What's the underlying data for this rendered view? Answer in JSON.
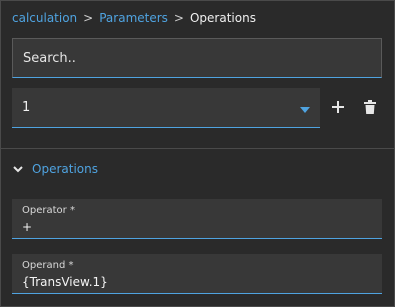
{
  "breadcrumb": {
    "items": [
      "calculation",
      "Parameters"
    ],
    "separator": ">",
    "current": "Operations"
  },
  "search": {
    "placeholder": "Search..",
    "value": ""
  },
  "selector": {
    "value": "1"
  },
  "actions": {
    "add_icon": "plus-icon",
    "delete_icon": "trash-icon"
  },
  "section": {
    "title": "Operations",
    "expanded": true
  },
  "fields": {
    "operator": {
      "label": "Operator *",
      "value": "+"
    },
    "operand": {
      "label": "Operand *",
      "value": "{TransView.1}"
    }
  },
  "colors": {
    "accent": "#4fa3e0",
    "background": "#2a2a2a",
    "field_bg": "#383838"
  }
}
